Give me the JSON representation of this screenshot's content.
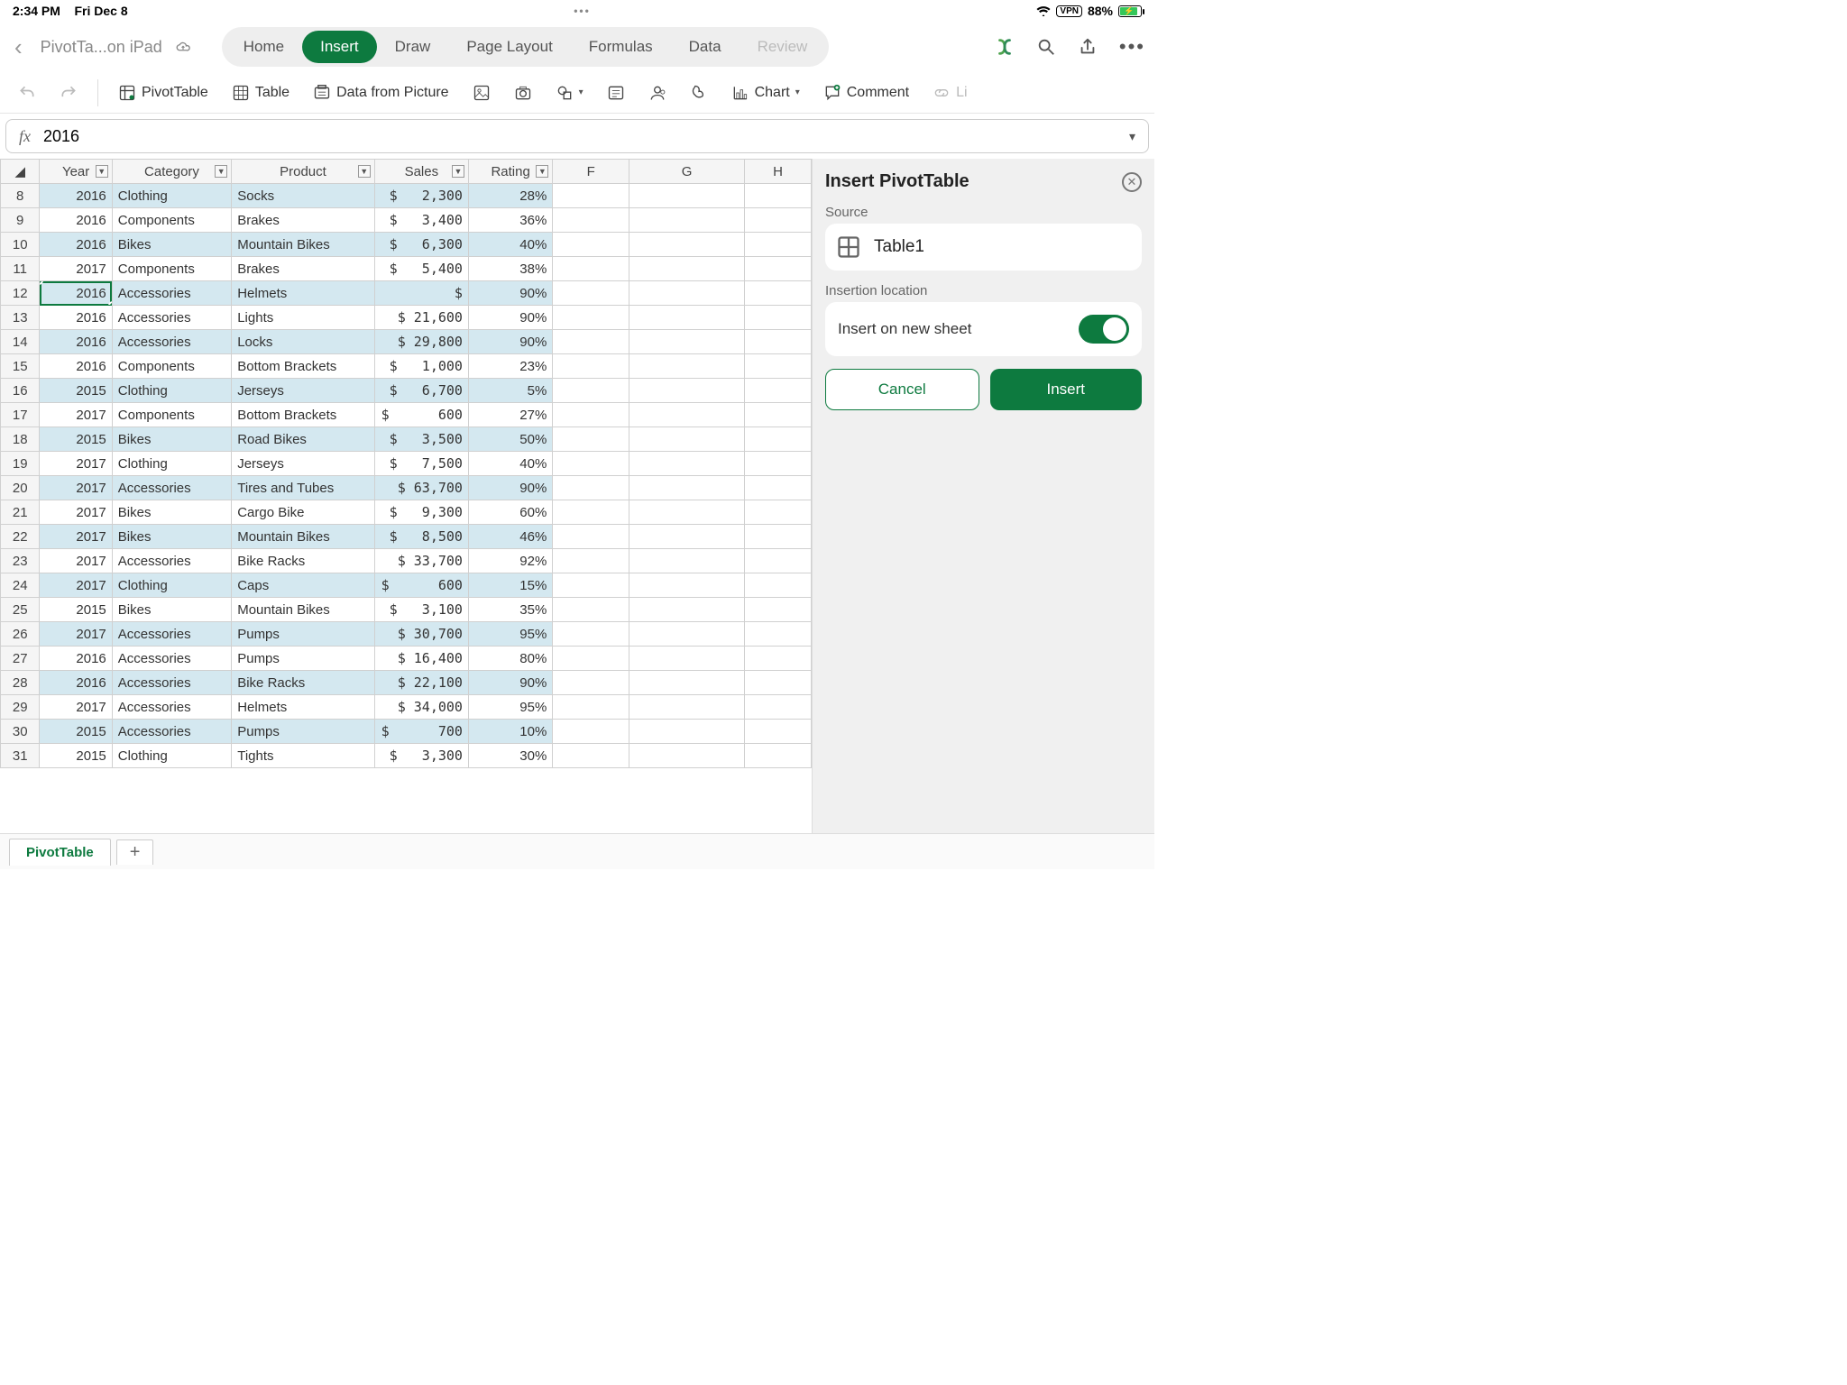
{
  "status": {
    "time": "2:34 PM",
    "date": "Fri Dec 8",
    "vpn": "VPN",
    "battery": "88%"
  },
  "doc_title": "PivotTa...on iPad",
  "tabs": {
    "home": "Home",
    "insert": "Insert",
    "draw": "Draw",
    "layout": "Page Layout",
    "formulas": "Formulas",
    "data": "Data",
    "review": "Review"
  },
  "toolbar": {
    "pivot": "PivotTable",
    "table": "Table",
    "picture": "Data from Picture",
    "chart": "Chart",
    "comment": "Comment",
    "link": "Li"
  },
  "formula": {
    "fx": "fx",
    "value": "2016"
  },
  "columns": {
    "A": "Year",
    "B": "Category",
    "C": "Product",
    "D": "Sales",
    "E": "Rating",
    "F": "F",
    "G": "G",
    "H": "H"
  },
  "rows": [
    {
      "n": 8,
      "year": "2016",
      "cat": "Clothing",
      "prod": "Socks",
      "sales": "$   2,300",
      "rating": "28%"
    },
    {
      "n": 9,
      "year": "2016",
      "cat": "Components",
      "prod": "Brakes",
      "sales": "$   3,400",
      "rating": "36%"
    },
    {
      "n": 10,
      "year": "2016",
      "cat": "Bikes",
      "prod": "Mountain Bikes",
      "sales": "$   6,300",
      "rating": "40%"
    },
    {
      "n": 11,
      "year": "2017",
      "cat": "Components",
      "prod": "Brakes",
      "sales": "$   5,400",
      "rating": "38%"
    },
    {
      "n": 12,
      "year": "2016",
      "cat": "Accessories",
      "prod": "Helmets",
      "sales": "$",
      "rating": "90%"
    },
    {
      "n": 13,
      "year": "2016",
      "cat": "Accessories",
      "prod": "Lights",
      "sales": "$ 21,600",
      "rating": "90%"
    },
    {
      "n": 14,
      "year": "2016",
      "cat": "Accessories",
      "prod": "Locks",
      "sales": "$ 29,800",
      "rating": "90%"
    },
    {
      "n": 15,
      "year": "2016",
      "cat": "Components",
      "prod": "Bottom Brackets",
      "sales": "$   1,000",
      "rating": "23%"
    },
    {
      "n": 16,
      "year": "2015",
      "cat": "Clothing",
      "prod": "Jerseys",
      "sales": "$   6,700",
      "rating": "5%"
    },
    {
      "n": 17,
      "year": "2017",
      "cat": "Components",
      "prod": "Bottom Brackets",
      "sales": "$      600",
      "rating": "27%"
    },
    {
      "n": 18,
      "year": "2015",
      "cat": "Bikes",
      "prod": "Road Bikes",
      "sales": "$   3,500",
      "rating": "50%"
    },
    {
      "n": 19,
      "year": "2017",
      "cat": "Clothing",
      "prod": "Jerseys",
      "sales": "$   7,500",
      "rating": "40%"
    },
    {
      "n": 20,
      "year": "2017",
      "cat": "Accessories",
      "prod": "Tires and Tubes",
      "sales": "$ 63,700",
      "rating": "90%"
    },
    {
      "n": 21,
      "year": "2017",
      "cat": "Bikes",
      "prod": "Cargo Bike",
      "sales": "$   9,300",
      "rating": "60%"
    },
    {
      "n": 22,
      "year": "2017",
      "cat": "Bikes",
      "prod": "Mountain Bikes",
      "sales": "$   8,500",
      "rating": "46%"
    },
    {
      "n": 23,
      "year": "2017",
      "cat": "Accessories",
      "prod": "Bike Racks",
      "sales": "$ 33,700",
      "rating": "92%"
    },
    {
      "n": 24,
      "year": "2017",
      "cat": "Clothing",
      "prod": "Caps",
      "sales": "$      600",
      "rating": "15%"
    },
    {
      "n": 25,
      "year": "2015",
      "cat": "Bikes",
      "prod": "Mountain Bikes",
      "sales": "$   3,100",
      "rating": "35%"
    },
    {
      "n": 26,
      "year": "2017",
      "cat": "Accessories",
      "prod": "Pumps",
      "sales": "$ 30,700",
      "rating": "95%"
    },
    {
      "n": 27,
      "year": "2016",
      "cat": "Accessories",
      "prod": "Pumps",
      "sales": "$ 16,400",
      "rating": "80%"
    },
    {
      "n": 28,
      "year": "2016",
      "cat": "Accessories",
      "prod": "Bike Racks",
      "sales": "$ 22,100",
      "rating": "90%"
    },
    {
      "n": 29,
      "year": "2017",
      "cat": "Accessories",
      "prod": "Helmets",
      "sales": "$ 34,000",
      "rating": "95%"
    },
    {
      "n": 30,
      "year": "2015",
      "cat": "Accessories",
      "prod": "Pumps",
      "sales": "$      700",
      "rating": "10%"
    },
    {
      "n": 31,
      "year": "2015",
      "cat": "Clothing",
      "prod": "Tights",
      "sales": "$   3,300",
      "rating": "30%"
    }
  ],
  "selected_row": 12,
  "panel": {
    "title": "Insert PivotTable",
    "source_label": "Source",
    "source_value": "Table1",
    "location_label": "Insertion location",
    "location_value": "Insert on new sheet",
    "cancel": "Cancel",
    "insert": "Insert"
  },
  "sheet_tab": "PivotTable"
}
